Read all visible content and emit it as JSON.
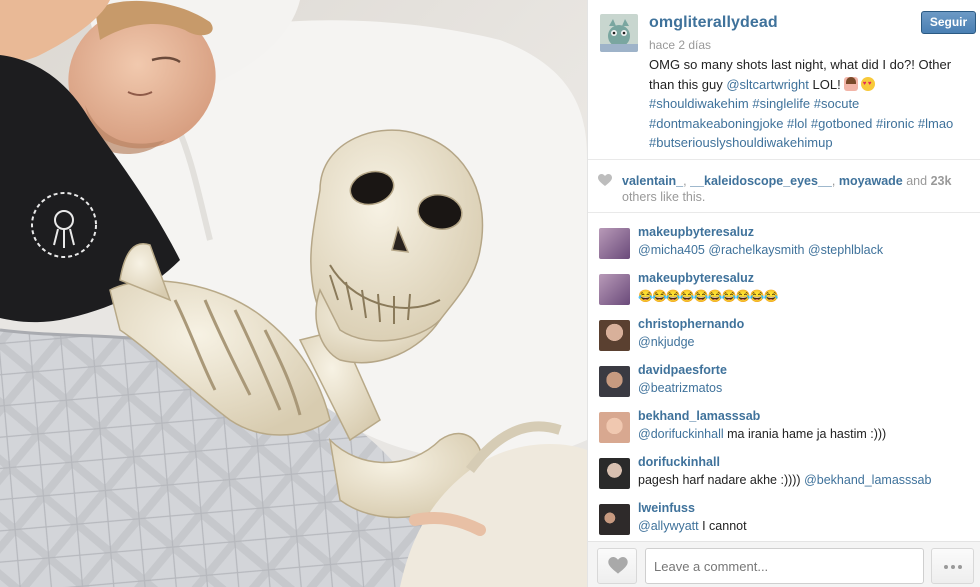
{
  "post": {
    "username": "omgliterallydead",
    "time": "hace 2 días",
    "follow_label": "Seguir",
    "caption_text": "OMG so many shots last night, what did I do?! Other than this guy",
    "caption_mention": "@sltcartwright",
    "caption_after": "LOL!",
    "caption_hashtags": "#shouldiwakehim #singlelife #socute #dontmakeaboningjoke #lol #gotboned #ironic #lmao #butseriouslyshouldiwakehimup"
  },
  "likes": {
    "user1": "valentain_",
    "user2": "__kaleidoscope_eyes__",
    "user3": "moyawade",
    "and_label": "and",
    "count": "23k",
    "suffix": "others like this."
  },
  "comments": [
    {
      "user": "makeupbyteresaluz",
      "mentions": "@micha405 @rachelkaysmith @stephlblack",
      "text": "",
      "avatar_color": "#8a6a9a"
    },
    {
      "user": "makeupbyteresaluz",
      "mentions": "",
      "text": "😂😂😂😂😂😂😂😂😂😂",
      "avatar_color": "#8a6a9a"
    },
    {
      "user": "christophernando",
      "mentions": "@nkjudge",
      "text": "",
      "avatar_color": "#6b5a4a"
    },
    {
      "user": "davidpaesforte",
      "mentions": "@beatrizmatos",
      "text": "",
      "avatar_color": "#4a4a52"
    },
    {
      "user": "bekhand_lamasssab",
      "mentions": "@dorifuckinhall",
      "text": "ma irania hame ja hastim :)))",
      "avatar_color": "#c9a38a"
    },
    {
      "user": "dorifuckinhall",
      "mentions": "",
      "text": "pagesh harf nadare akhe :))))",
      "mentions_after": "@bekhand_lamasssab",
      "avatar_color": "#3a3a3a"
    },
    {
      "user": "lweinfuss",
      "mentions": "@allywyatt",
      "text": "I cannot",
      "avatar_color": "#2e2a2a"
    }
  ],
  "footer": {
    "comment_placeholder": "Leave a comment..."
  },
  "colors": {
    "link_blue": "#3f729b",
    "follow_button": "#4a7fb3"
  },
  "icons": [
    "heart-icon",
    "more-dots-icon",
    "emoji-woman-icon",
    "emoji-heart-eyes-icon",
    "emoji-laughing-icon"
  ]
}
